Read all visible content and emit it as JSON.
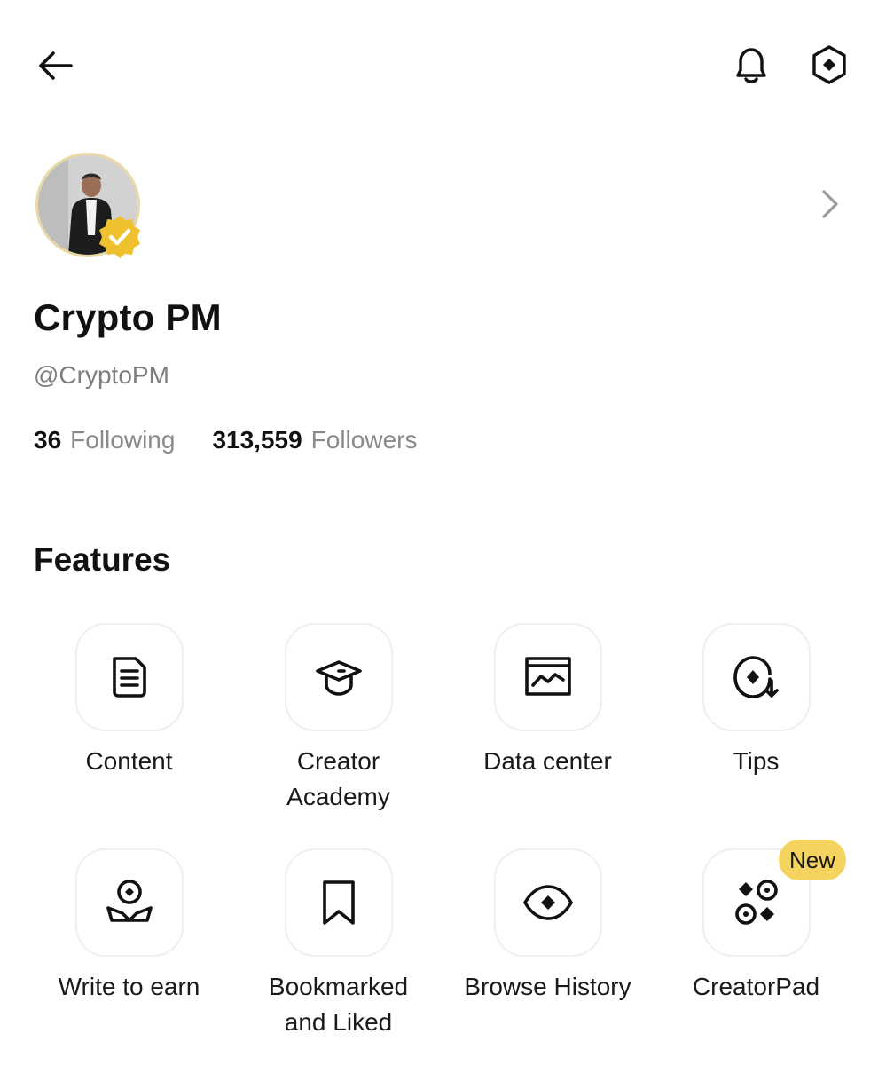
{
  "header": {
    "back_icon": "arrow-left-icon",
    "notifications_icon": "bell-icon",
    "settings_icon": "hexagon-diamond-icon"
  },
  "profile": {
    "name": "Crypto PM",
    "handle": "@CryptoPM",
    "verified_color": "#f0c12e",
    "following_count": "36",
    "following_label": "Following",
    "followers_count": "313,559",
    "followers_label": "Followers"
  },
  "features": {
    "title": "Features",
    "items": [
      {
        "label": "Content",
        "icon": "document-icon"
      },
      {
        "label": "Creator\nAcademy",
        "icon": "graduation-cap-icon"
      },
      {
        "label": "Data center",
        "icon": "chart-window-icon"
      },
      {
        "label": "Tips",
        "icon": "tips-icon"
      },
      {
        "label": "Write to earn",
        "icon": "write-to-earn-icon"
      },
      {
        "label": "Bookmarked\nand Liked",
        "icon": "bookmark-icon"
      },
      {
        "label": "Browse History",
        "icon": "eye-icon"
      },
      {
        "label": "CreatorPad",
        "icon": "creatorpad-icon",
        "badge": "New"
      }
    ]
  },
  "colors": {
    "badge_bg": "#f4d35e",
    "muted_text": "#8a8a8a",
    "tile_border": "#efefef"
  }
}
